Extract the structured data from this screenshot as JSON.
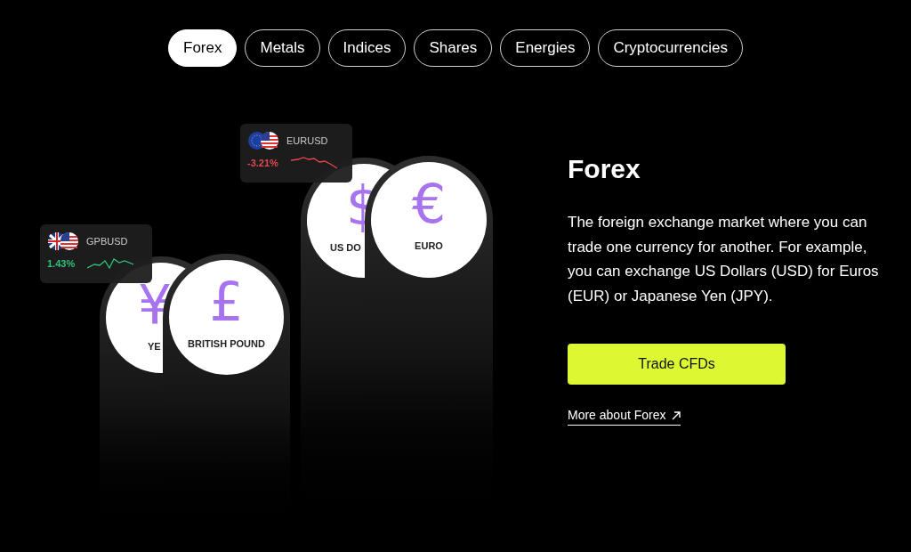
{
  "tabs": [
    {
      "label": "Forex",
      "selected": true
    },
    {
      "label": "Metals",
      "selected": false
    },
    {
      "label": "Indices",
      "selected": false
    },
    {
      "label": "Shares",
      "selected": false
    },
    {
      "label": "Energies",
      "selected": false
    },
    {
      "label": "Cryptocurrencies",
      "selected": false
    }
  ],
  "currencies": [
    {
      "symbol": "¥",
      "label": "YE"
    },
    {
      "symbol": "£",
      "label": "BRITISH POUND"
    },
    {
      "symbol": "$",
      "label": "US DO"
    },
    {
      "symbol": "€",
      "label": "EURO"
    }
  ],
  "pairs": [
    {
      "pair": "GPBUSD",
      "change": "1.43%",
      "color": "#2fc27a",
      "kind": "pound"
    },
    {
      "pair": "EURUSD",
      "change": "-3.21%",
      "color": "#e5484d",
      "kind": "euro"
    }
  ],
  "panel": {
    "title": "Forex",
    "description": "The foreign exchange market where you can trade one currency for another. For example, you can exchange US Dollars (USD) for Euros (EUR) or Japanese Yen (JPY).",
    "button": "Trade CFDs",
    "link": "More about Forex"
  }
}
